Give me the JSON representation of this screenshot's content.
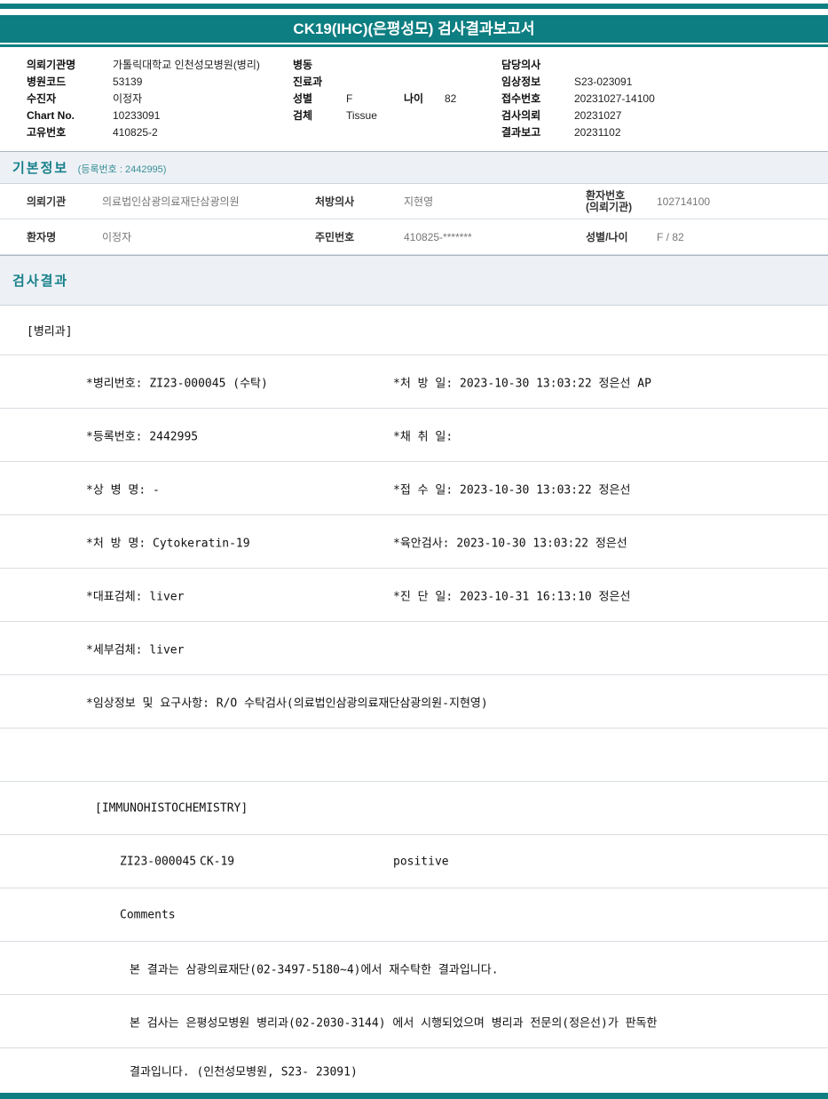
{
  "title": "CK19(IHC)(은평성모) 검사결과보고서",
  "header": {
    "col1": [
      {
        "label": "의뢰기관명",
        "value": "가톨릭대학교 인천성모병원(병리)"
      },
      {
        "label": "병원코드",
        "value": "53139"
      },
      {
        "label": "수진자",
        "value": "이정자"
      },
      {
        "label": "Chart No.",
        "value": "10233091"
      },
      {
        "label": "고유번호",
        "value": "410825-2"
      }
    ],
    "col2": {
      "ward_label": "병동",
      "dept_label": "진료과",
      "sex_label": "성별",
      "sex_value": "F",
      "age_label": "나이",
      "age_value": "82",
      "specimen_label": "검체",
      "specimen_value": "Tissue"
    },
    "col3": [
      {
        "label": "담당의사",
        "value": ""
      },
      {
        "label": "임상정보",
        "value": "S23-023091"
      },
      {
        "label": "접수번호",
        "value": "20231027-14100"
      },
      {
        "label": "검사의뢰",
        "value": "20231027"
      },
      {
        "label": "결과보고",
        "value": "20231102"
      }
    ]
  },
  "basic_info": {
    "section_title": "기본정보",
    "section_sub": "(등록번호 : 2442995)",
    "rows": [
      {
        "l1": "의뢰기관",
        "v1": "의료법인삼광의료재단삼광의원",
        "l2": "처방의사",
        "v2": "지현영",
        "l3a": "환자번호",
        "l3b": "(의뢰기관)",
        "v3": "102714100"
      },
      {
        "l1": "환자명",
        "v1": "이정자",
        "l2": "주민번호",
        "v2": "410825-*******",
        "l3a": "성별/나이",
        "l3b": "",
        "v3": "F / 82"
      }
    ]
  },
  "results": {
    "section_title": "검사결과",
    "department": "[병리과]",
    "detail_rows": [
      {
        "left": "*병리번호: ZI23-000045 (수탁)",
        "right": "*처 방 일: 2023-10-30 13:03:22  정은선 AP"
      },
      {
        "left": "*등록번호: 2442995",
        "right": "*채 취 일:"
      },
      {
        "left": "*상 병 명: -",
        "right": "*접 수 일: 2023-10-30 13:03:22  정은선"
      },
      {
        "left": "*처 방 명: Cytokeratin-19",
        "right": "*육안검사: 2023-10-30 13:03:22  정은선"
      },
      {
        "left": "*대표검체: liver",
        "right": "*진 단 일: 2023-10-31 16:13:10  정은선"
      },
      {
        "left": "*세부검체: liver",
        "right": ""
      },
      {
        "left": "*임상정보 및 요구사항: R/O 수탁검사(의료법인삼광의료재단삼광의원-지현영)",
        "right": ""
      }
    ],
    "ihc_header": "[IMMUNOHISTOCHEMISTRY]",
    "ihc_row": {
      "specimen": "ZI23-000045",
      "test": "CK-19",
      "result": "positive"
    },
    "comments_label": "Comments",
    "comment_lines": [
      "본 결과는 삼광의료재단(02-3497-5180~4)에서 재수탁한 결과입니다.",
      "본 검사는 은평성모병원 병리과(02-2030-3144) 에서 시행되었으며 병리과 전문의(정은선)가 판독한",
      "결과입니다. (인천성모병원, S23- 23091)"
    ]
  }
}
